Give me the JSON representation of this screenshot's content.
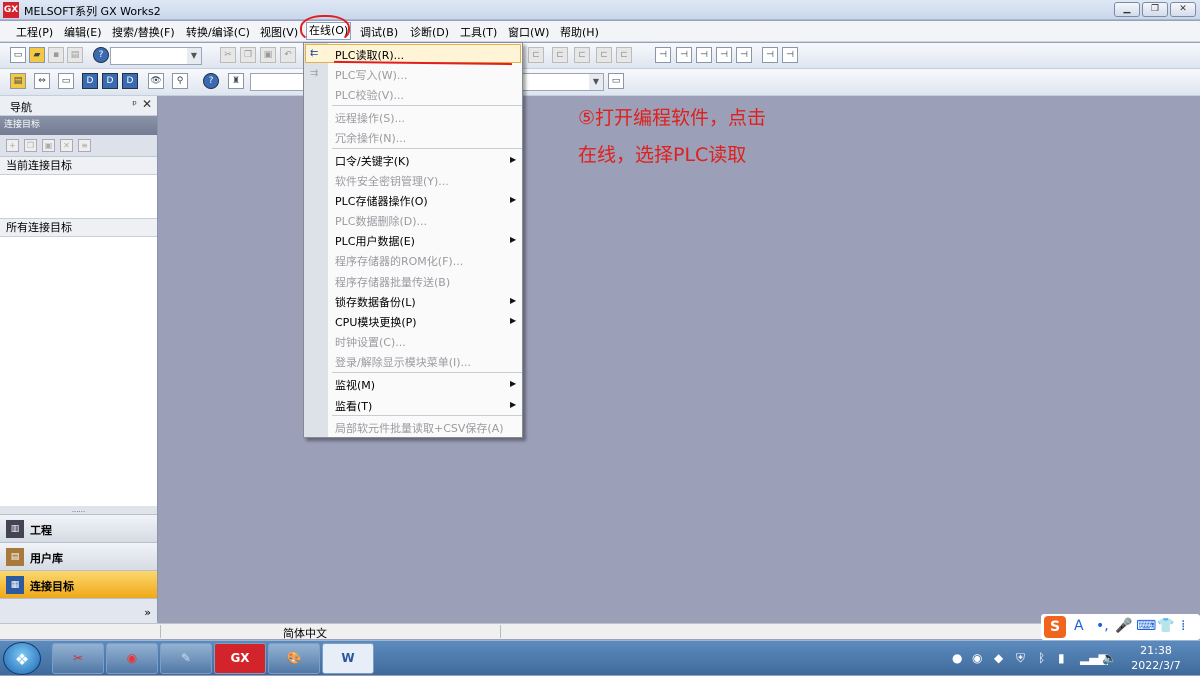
{
  "window": {
    "title": "MELSOFT系列 GX Works2",
    "minimize": "▁",
    "restore": "❐",
    "close": "✕",
    "logo": "GX"
  },
  "menubar": {
    "items": [
      "工程(P)",
      "编辑(E)",
      "搜索/替换(F)",
      "转换/编译(C)",
      "视图(V)",
      "在线(O)",
      "调试(B)",
      "诊断(D)",
      "工具(T)",
      "窗口(W)",
      "帮助(H)"
    ]
  },
  "toolbar": {
    "icons": [
      "new-file-icon",
      "open-folder-icon",
      "save-icon",
      "print-icon",
      "help-icon",
      "cut-icon",
      "copy-icon",
      "paste-icon",
      "undo-icon"
    ]
  },
  "navigation": {
    "title": "导航",
    "pin": "ᵖ",
    "close": "✕",
    "connection_header": "连接目标",
    "current_target": "当前连接目标",
    "all_targets": "所有连接目标",
    "grip": "......",
    "tabs": [
      {
        "label": "工程",
        "icon": "project-icon",
        "active": false
      },
      {
        "label": "用户库",
        "icon": "library-icon",
        "active": false
      },
      {
        "label": "连接目标",
        "icon": "connection-icon",
        "active": true
      }
    ],
    "more": "»"
  },
  "online_menu": {
    "items": [
      {
        "label": "PLC读取(R)...",
        "enabled": true,
        "highlighted": true,
        "submenu": false,
        "icon": "plc-read-icon"
      },
      {
        "label": "PLC写入(W)...",
        "enabled": false,
        "submenu": false,
        "icon": "plc-write-icon"
      },
      {
        "label": "PLC校验(V)...",
        "enabled": false,
        "submenu": false
      },
      {
        "label": "远程操作(S)...",
        "enabled": false,
        "submenu": false
      },
      {
        "label": "冗余操作(N)...",
        "enabled": false,
        "submenu": false
      },
      {
        "label": "口令/关键字(K)",
        "enabled": true,
        "submenu": true
      },
      {
        "label": "软件安全密钥管理(Y)...",
        "enabled": false,
        "submenu": false
      },
      {
        "label": "PLC存储器操作(O)",
        "enabled": true,
        "submenu": true
      },
      {
        "label": "PLC数据删除(D)...",
        "enabled": false,
        "submenu": false
      },
      {
        "label": "PLC用户数据(E)",
        "enabled": true,
        "submenu": true
      },
      {
        "label": "程序存储器的ROM化(F)...",
        "enabled": false,
        "submenu": false
      },
      {
        "label": "程序存储器批量传送(B)",
        "enabled": false,
        "submenu": false
      },
      {
        "label": "锁存数据备份(L)",
        "enabled": true,
        "submenu": true
      },
      {
        "label": "CPU模块更换(P)",
        "enabled": true,
        "submenu": true
      },
      {
        "label": "时钟设置(C)...",
        "enabled": false,
        "submenu": false
      },
      {
        "label": "登录/解除显示模块菜单(I)...",
        "enabled": false,
        "submenu": false
      },
      {
        "label": "监视(M)",
        "enabled": true,
        "submenu": true
      },
      {
        "label": "监看(T)",
        "enabled": true,
        "submenu": true
      },
      {
        "label": "局部软元件批量读取+CSV保存(A)",
        "enabled": false,
        "submenu": false
      }
    ]
  },
  "annotation": {
    "line1": "⑤打开编程软件，点击",
    "line2": "在线，选择PLC读取",
    "color": "#e0201b"
  },
  "statusbar": {
    "language": "简体中文"
  },
  "taskbar": {
    "start": "❖",
    "apps": [
      {
        "name": "paint-tool",
        "glyph": "✂"
      },
      {
        "name": "chrome",
        "glyph": "◉"
      },
      {
        "name": "notes",
        "glyph": "✎"
      },
      {
        "name": "gx-works",
        "glyph": "GX"
      },
      {
        "name": "paint",
        "glyph": "🎨"
      },
      {
        "name": "word",
        "glyph": "W"
      }
    ],
    "time": "21:38",
    "date": "2022/3/7"
  },
  "ime": {
    "logo": "S",
    "items": [
      "A",
      "•,",
      "🎤",
      "⌨",
      "👕",
      "⁞"
    ]
  }
}
